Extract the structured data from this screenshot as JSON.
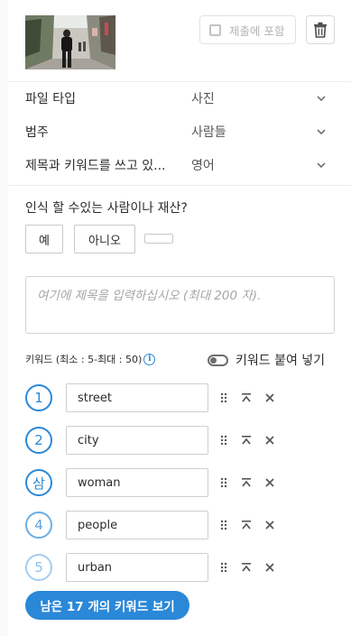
{
  "header": {
    "include_label": "제출에 포함"
  },
  "fields": [
    {
      "label": "파일 타입",
      "value": "사진"
    },
    {
      "label": "범주",
      "value": "사람들"
    },
    {
      "label": "제목과 키워드를 쓰고 있...",
      "value": "영어"
    }
  ],
  "recognizable": {
    "question": "인식 할 수있는 사람이나 재산?",
    "yes_label": "예",
    "no_label": "아니오",
    "third_label": ""
  },
  "title_field": {
    "placeholder": "여기에 제목을 입력하십시오 (최대 200 자)."
  },
  "keywords": {
    "header": "키워드 (최소 : 5-최대 : 50)",
    "info_icon_glyph": "i",
    "paste_label": "키워드 붙여 넣기",
    "items": [
      {
        "num": "1",
        "text": "street"
      },
      {
        "num": "2",
        "text": "city"
      },
      {
        "num": "삼",
        "text": "woman"
      },
      {
        "num": "4",
        "text": "people"
      },
      {
        "num": "5",
        "text": "urban"
      }
    ],
    "more_label": "남은 17 개의 키워드 보기"
  },
  "icons": [
    "thumbnail-image",
    "checkbox-icon",
    "trash-icon",
    "chevron-down-icon",
    "info-icon",
    "toggle-icon",
    "drag-handle-icon",
    "move-to-top-icon",
    "remove-icon"
  ],
  "colors": {
    "accent": "#2b88d8",
    "text": "#2c2c2c",
    "muted": "#a6a6a6",
    "border": "#cfcfcf",
    "background": "#fafafa"
  }
}
